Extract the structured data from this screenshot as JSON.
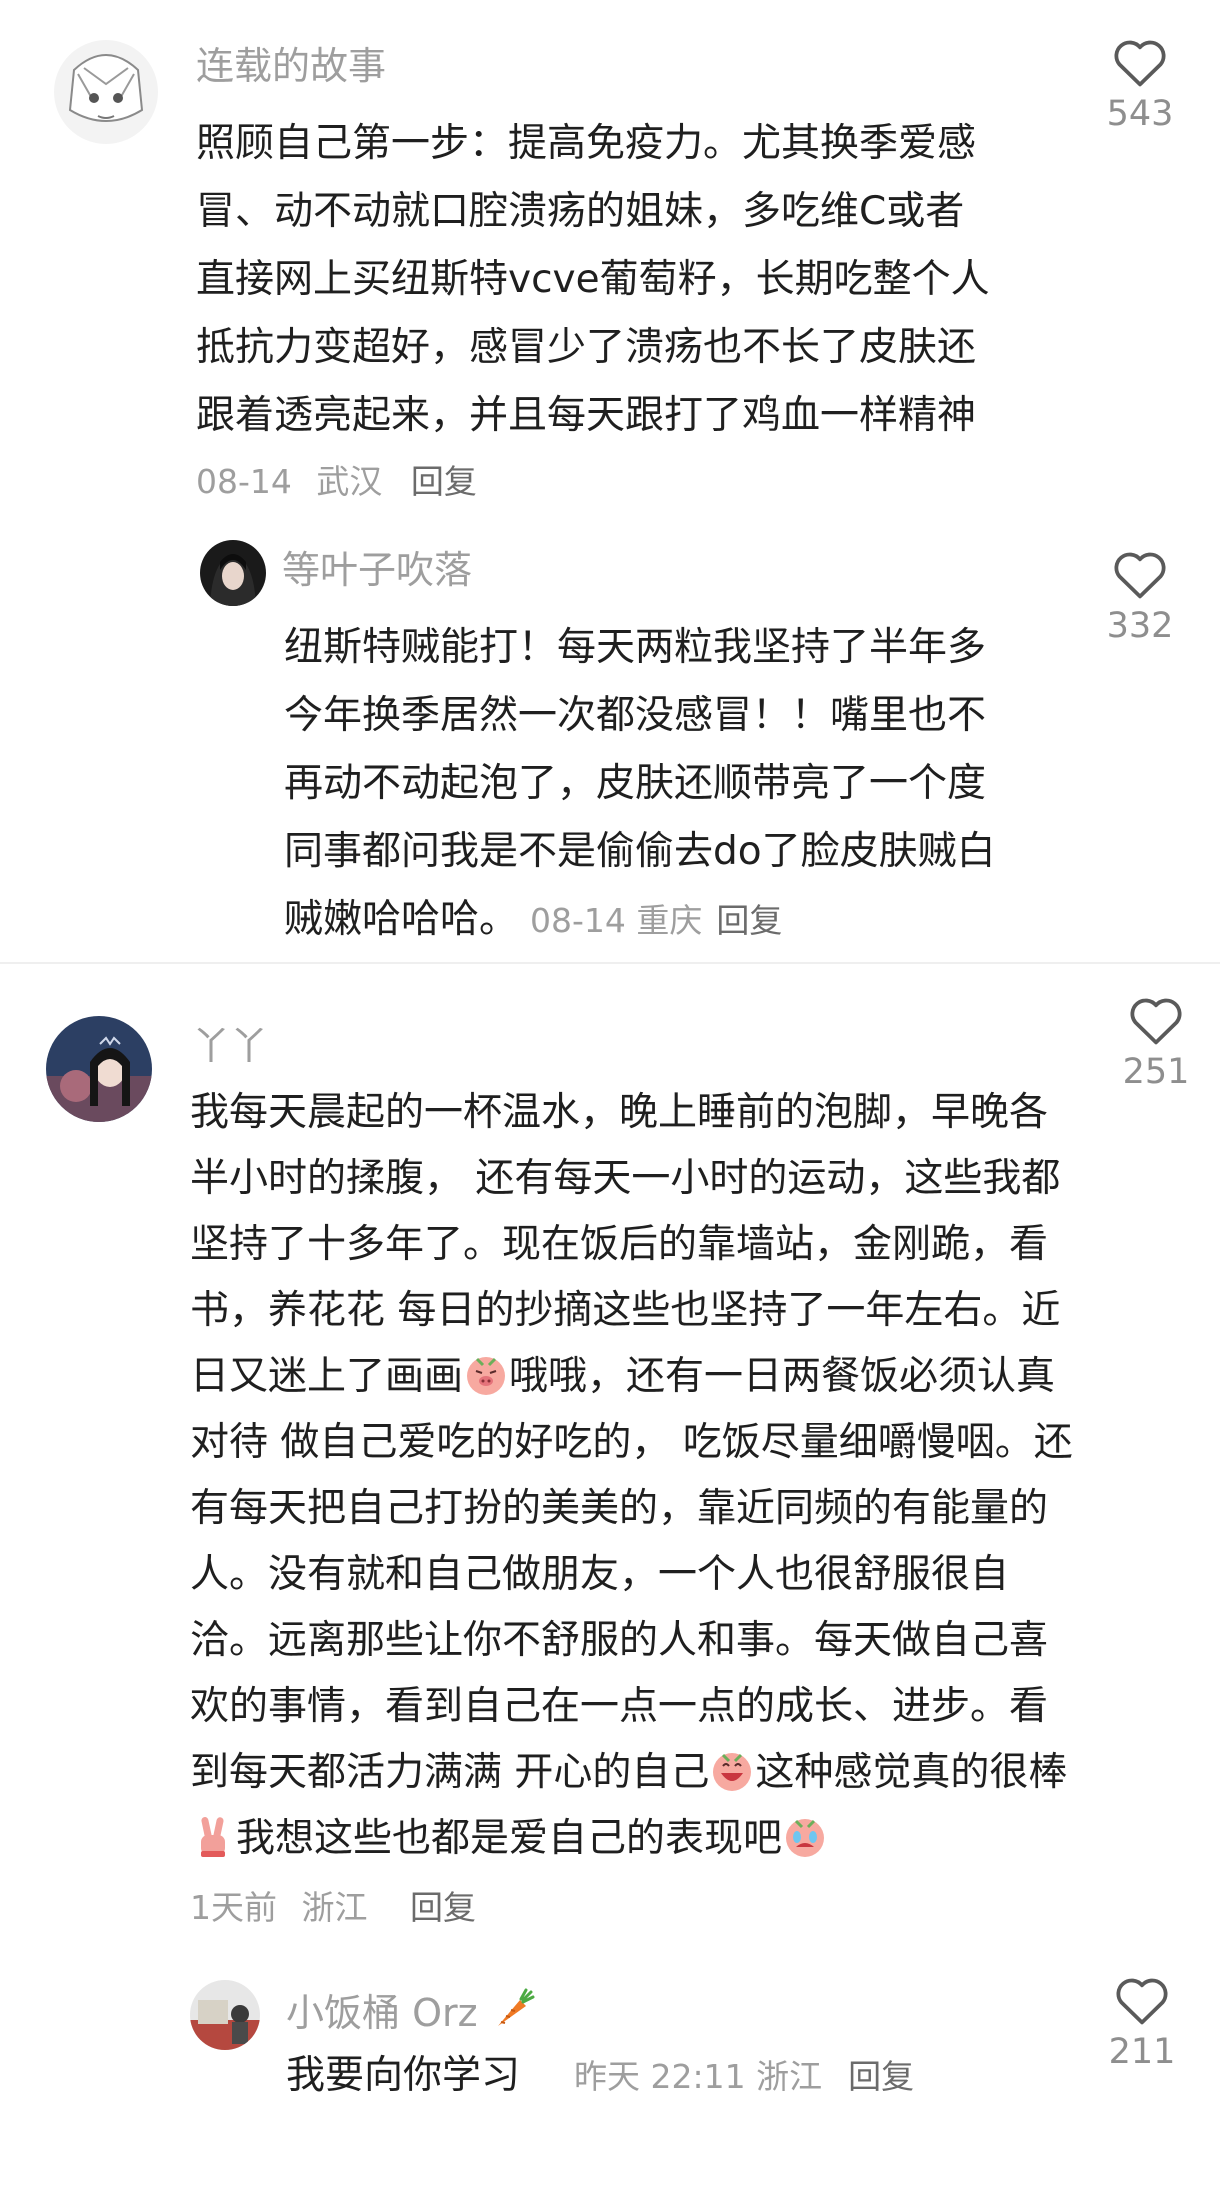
{
  "comments": [
    {
      "name": "连载的故事",
      "likes": "543",
      "lines": [
        "照顾自己第一步：提高免疫力。尤其换季爱感",
        "冒、动不动就口腔溃疡的姐妹，多吃维C或者",
        "直接网上买纽斯特vcve葡萄籽，长期吃整个人",
        "抵抗力变超好，感冒少了溃疡也不长了皮肤还",
        "跟着透亮起来，并且每天跟打了鸡血一样精神"
      ],
      "date": "08-14",
      "location": "武汉",
      "reply_label": "回复"
    },
    {
      "name": "等叶子吹落",
      "likes": "332",
      "lines": [
        "纽斯特贼能打！每天两粒我坚持了半年多",
        "今年换季居然一次都没感冒！！嘴里也不",
        "再动不动起泡了，皮肤还顺带亮了一个度",
        "同事都问我是不是偷偷去do了脸皮肤贼白",
        "贼嫩哈哈哈。"
      ],
      "date": "08-14",
      "location": "重庆",
      "reply_label": "回复"
    },
    {
      "name": "丫丫",
      "likes": "251",
      "lines": [
        "我每天晨起的一杯温水，晚上睡前的泡脚，早晚各",
        "半小时的揉腹， 还有每天一小时的运动，这些我都",
        "坚持了十多年了。现在饭后的靠墙站，金刚跪，看",
        "书，养花花 每日的抄摘这些也坚持了一年左右。近",
        "日又迷上了画画",
        "哦哦，还有一日两餐饭必须认真",
        "对待 做自己爱吃的好吃的， 吃饭尽量细嚼慢咽。还",
        "有每天把自己打扮的美美的，靠近同频的有能量的",
        "人。没有就和自己做朋友，一个人也很舒服很自",
        "洽。远离那些让你不舒服的人和事。每天做自己喜",
        "欢的事情，看到自己在一点一点的成长、进步。看",
        "到每天都活力满满 开心的自己",
        "这种感觉真的很棒",
        "我想这些也都是爱自己的表现吧"
      ],
      "time": "1天前",
      "location": "浙江",
      "reply_label": "回复"
    },
    {
      "name": "小饭桶 Orz",
      "likes": "211",
      "text": "我要向你学习",
      "time": "昨天 22:11",
      "location": "浙江",
      "reply_label": "回复"
    }
  ],
  "icons": {
    "like": "heart-outline-icon",
    "carrot": "carrot-emoji-icon",
    "emoji_pig_smirk": "pig-smirk-emoji-icon",
    "emoji_pig_grin": "pig-grin-emoji-icon",
    "emoji_victory": "victory-hand-emoji-icon",
    "emoji_pig_cry": "pig-cry-emoji-icon"
  },
  "colors": {
    "text": "#1f1f1f",
    "muted": "#9e9e9e",
    "divider": "#efefef"
  }
}
